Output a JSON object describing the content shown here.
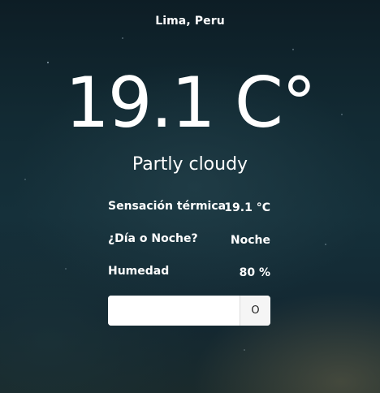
{
  "location": "Lima, Peru",
  "temperature": "19.1 C°",
  "condition": "Partly cloudy",
  "details": [
    {
      "label": "Sensación térmica",
      "value": "19.1 °C"
    },
    {
      "label": "¿Día o Noche?",
      "value": "Noche"
    },
    {
      "label": "Humedad",
      "value": "80 %"
    }
  ],
  "search": {
    "value": "",
    "placeholder": "",
    "button_label": "O"
  }
}
